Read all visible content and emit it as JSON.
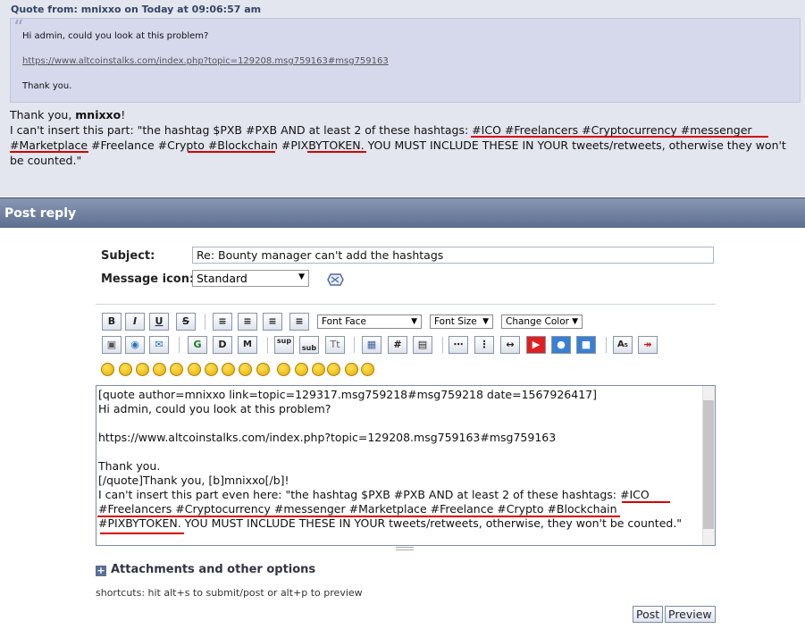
{
  "quote": {
    "header": "Quote from: mnixxo on Today at 09:06:57 am",
    "line1": "Hi admin, could you look at this problem?",
    "link": "https://www.altcoinstalks.com/index.php?topic=129208.msg759163#msg759163",
    "line3": "Thank you."
  },
  "post": {
    "thank_prefix": "Thank you, ",
    "thank_name": "mnixxo",
    "thank_suffix": "!",
    "line2": "I can't insert this part: \"the hashtag $PXB #PXB AND at least 2 of these hashtags: #ICO #Freelancers #Cryptocurrency #messenger",
    "line3": "#Marketplace #Freelance #Crypto #Blockchain #PIXBYTOKEN. YOU MUST INCLUDE THESE IN YOUR tweets/retweets, otherwise they won't",
    "line4": "be counted.\""
  },
  "reply_bar": {
    "title": "Post reply"
  },
  "form": {
    "subject_label": "Subject:",
    "subject_value": "Re: Bounty manager can't add the hashtags",
    "icon_label": "Message icon:",
    "icon_value": "Standard"
  },
  "toolbar": {
    "font_face": "Font Face",
    "font_size": "Font Size",
    "change_color": "Change Color",
    "bold": "B",
    "italic": "I",
    "underline": "U",
    "strike": "S",
    "glow": "G",
    "shadow": "D",
    "move": "M",
    "sup": "sup",
    "sub": "sub",
    "tt": "Tt",
    "hash": "#"
  },
  "message": {
    "lines": [
      "[quote author=mnixxo link=topic=129317.msg759218#msg759218 date=1567926417]",
      "Hi admin, could you look at this problem?",
      "",
      "https://www.altcoinstalks.com/index.php?topic=129208.msg759163#msg759163",
      "",
      "Thank you.",
      "[/quote]Thank you, [b]mnixxo[/b]!",
      "I can't insert this part even here: \"the hashtag $PXB #PXB AND at least 2 of these hashtags: #ICO",
      "#Freelancers #Cryptocurrency #messenger #Marketplace #Freelance #Crypto #Blockchain",
      "#PIXBYTOKEN. YOU MUST INCLUDE THESE IN YOUR tweets/retweets, otherwise, they won't be counted.\""
    ]
  },
  "attachments_label": "Attachments and other options",
  "shortcuts": "shortcuts: hit alt+s to submit/post or alt+p to preview",
  "buttons": {
    "post": "Post",
    "preview": "Preview"
  },
  "colors": {
    "reply_bar": "#6a7b9c",
    "quote_bg": "#d6d9ec",
    "highlight": "#d40000"
  }
}
